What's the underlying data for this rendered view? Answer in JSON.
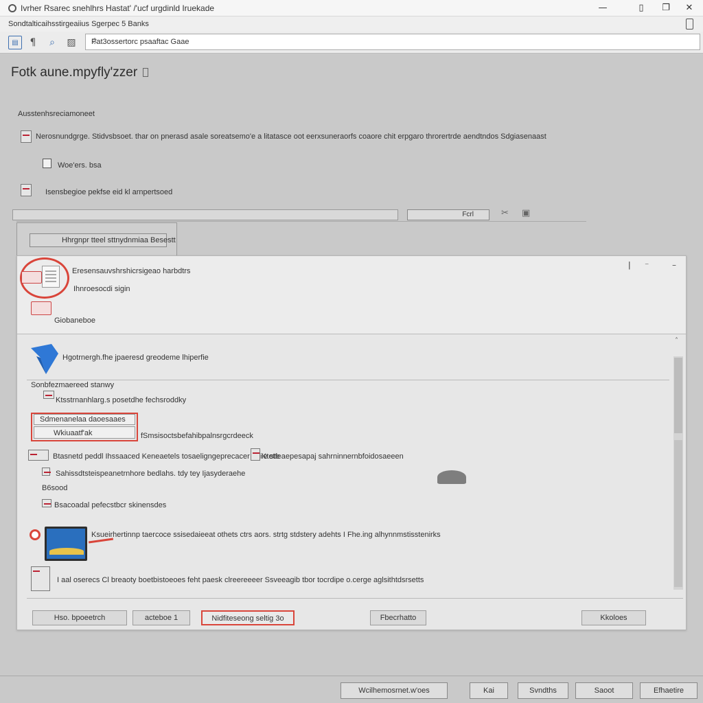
{
  "window": {
    "title": "Ivrher Rsarec snehlhrs Hastat' /'ucf urgdinld Iruekade",
    "controls": {
      "minimize": "—",
      "restore": "▯",
      "copy": "❐",
      "close": "✕"
    }
  },
  "menubar": {
    "text": "Sondtalticaihsstirgeaiius Sgerpec 5 Banks"
  },
  "toolbar": {
    "address_value": "Pat3ossertorc psaaftac Gaae",
    "icons": [
      "home-icon",
      "pin-icon",
      "search-icon",
      "image-icon"
    ]
  },
  "main": {
    "title": "Fotk aune.mpyfly'zzer",
    "section_label": "Ausstenhsreciamoneet",
    "rows": [
      "Nerosnundgrge. Stidvsbsoet. thar on pnerasd asale soreatsemo'e a litatasce oot eerxsuneraorfs coaore chit erpgaro throrertrde aendtndos Sdgiasenaast",
      "Woe'ers. bsa",
      "Isensbegioe pekfse eid kl arnpertsoed"
    ],
    "ribbon_box_text": "Fcrl",
    "subpanel_button": "Hhrgnpr tteel sttnydnmiaa Besestt"
  },
  "dialog": {
    "head_lines": [
      "Eresensauvshrshicrsigeao harbdtrs",
      "Ihnroesocdi sigin",
      "Giobaneboe"
    ],
    "blue_item": "Hgotrnergh.fhe jpaeresd greodeme lhiperfie",
    "group_label": "Sonbfezmaereed stanwy",
    "items": [
      "Ktsstrnanhlarg.s posetdhe fechsroddky",
      "Sdmenanelaa daoesaaes",
      "Wkiuaatf'ak",
      "fSmsisoctsbefahibpalnsrgcrdeeck",
      "Btasnetd peddl Ihssaaced Keneaetels tosaeligngeprecacer ooi'e ste",
      "Ktetfeaepesapaj sahrninnernbfoidosaeeen",
      "Sahissdtsteispeanetrnhore bedlahs. tdy tey Ijasyderaehe",
      "B6sood",
      "Bsacoadal pefecstbcr skinensdes",
      "Ksueirhertinnp taercoce ssisedaieeat othets ctrs aors. strtg stdstery adehts I Fhe.ing alhynnmstisstenirks",
      "I aal oserecs Cl breaoty boetbistoeoes feht paesk clreereeeer Ssveeagib tbor tocrdipe o.cerge aglsithtdsrsetts"
    ],
    "buttons": [
      "Hso. bpoeetrch",
      "acteboe 1",
      "Nidfiteseong seltig 3o",
      "Fbecrhatto",
      "Kkoloes"
    ]
  },
  "bottom_bar": [
    "Wcilhemosrnet.w'oes",
    "Kai",
    "Svndths",
    "Saoot",
    "Efhaetire"
  ],
  "colors": {
    "accent_red": "#d9453a",
    "blue": "#2a6fbe"
  }
}
